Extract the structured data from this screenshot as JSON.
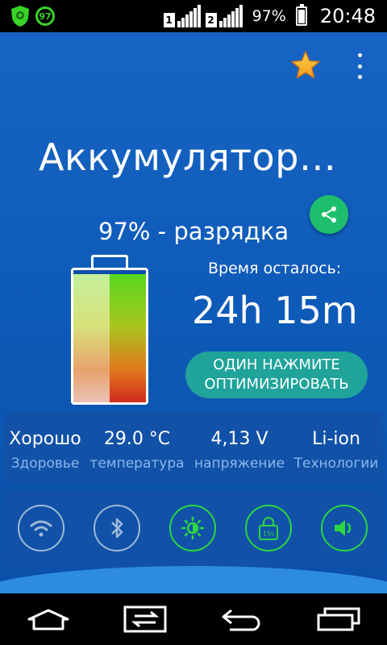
{
  "status_bar": {
    "notification_badge": "97",
    "sim1": "1",
    "sim2": "2",
    "battery_percent": "97%",
    "battery_level": 0.97,
    "time": "20:48",
    "icons": [
      "shield-icon",
      "signal-icon",
      "battery-icon"
    ]
  },
  "header": {
    "title": "Аккумулятор…",
    "favorite_icon": "star-icon",
    "menu_icon": "more-vert-icon",
    "share_icon": "share-icon"
  },
  "battery": {
    "status": "97% - разрядка",
    "level": 0.97,
    "remaining_label": "Время осталось:",
    "remaining_value": "24h 15m"
  },
  "optimize_button": {
    "line1": "ОДИН НАЖМИТЕ",
    "line2": "ОПТИМИЗИРОВАТЬ"
  },
  "stats": [
    {
      "value": "Хорошо",
      "label": "Здоровье"
    },
    {
      "value": "29.0 °C",
      "label": "температура"
    },
    {
      "value": "4,13 V",
      "label": "напряжение"
    },
    {
      "value": "Li-ion",
      "label": "Технологии"
    }
  ],
  "toggles": [
    {
      "name": "wifi",
      "icon": "wifi-icon",
      "on": false
    },
    {
      "name": "bluetooth",
      "icon": "bluetooth-icon",
      "on": false
    },
    {
      "name": "brightness",
      "icon": "brightness-icon",
      "on": true
    },
    {
      "name": "screen-timeout",
      "icon": "lock-timer-icon",
      "label": "15s",
      "on": true
    },
    {
      "name": "sound",
      "icon": "volume-icon",
      "on": true
    }
  ],
  "colors": {
    "background": "#1764c4",
    "card": "#1152a8",
    "accent_green": "#2bd640",
    "share_green": "#1ebf6c",
    "optimize_teal": "#1fa39a"
  },
  "nav_bar": [
    "home-icon",
    "switch-icon",
    "back-icon",
    "recents-icon"
  ]
}
